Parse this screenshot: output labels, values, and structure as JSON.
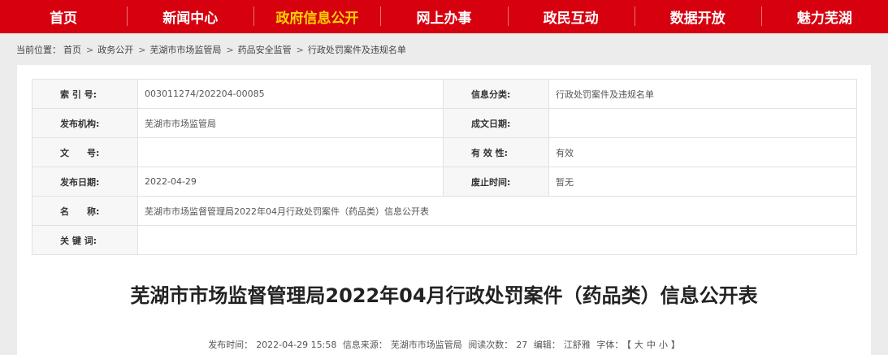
{
  "nav": {
    "items": [
      "首页",
      "新闻中心",
      "政府信息公开",
      "网上办事",
      "政民互动",
      "数据开放",
      "魅力芜湖"
    ],
    "active_index": 2
  },
  "breadcrumb": {
    "prefix": "当前位置：",
    "items": [
      "首页",
      "政务公开",
      "芜湖市市场监管局",
      "药品安全监管",
      "行政处罚案件及违规名单"
    ]
  },
  "meta": {
    "rows": [
      {
        "k1": "索 引 号:",
        "v1": "003011274/202204-00085",
        "k2": "信息分类:",
        "v2": "行政处罚案件及违规名单"
      },
      {
        "k1": "发布机构:",
        "v1": "芜湖市市场监管局",
        "k2": "成文日期:",
        "v2": ""
      },
      {
        "k1": "文　　号:",
        "v1": "",
        "k2": "有 效 性:",
        "v2": "有效"
      },
      {
        "k1": "发布日期:",
        "v1": "2022-04-29",
        "k2": "废止时间:",
        "v2": "暂无"
      }
    ],
    "name_label": "名　　称:",
    "name_value": "芜湖市市场监督管理局2022年04月行政处罚案件（药品类）信息公开表",
    "keywords_label": "关 键 词:",
    "keywords_value": ""
  },
  "article": {
    "title": "芜湖市市场监督管理局2022年04月行政处罚案件（药品类）信息公开表",
    "publish_label": "发布时间：",
    "publish_time": "2022-04-29 15:58",
    "source_label": "信息来源：",
    "source": "芜湖市市场监管局",
    "views_label": "阅读次数：",
    "views": "27",
    "editor_label": "编辑：",
    "editor": "江舒雅",
    "font_label": "字体：",
    "font_open": "【",
    "font_large": "大",
    "font_medium": "中",
    "font_small": "小",
    "font_close": "】"
  }
}
